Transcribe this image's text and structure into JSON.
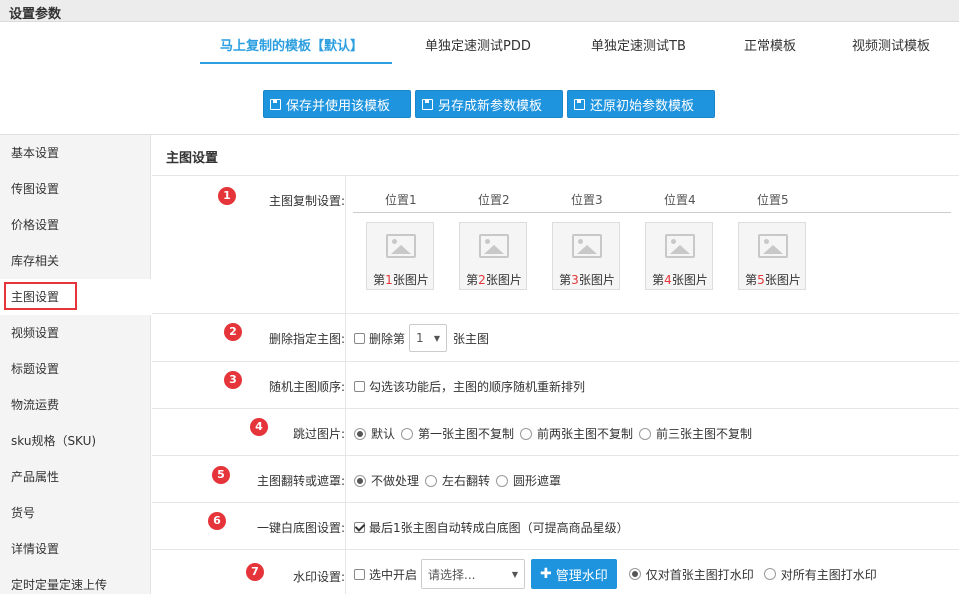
{
  "window": {
    "title": "设置参数"
  },
  "tabs": [
    {
      "label": "马上复制的模板【默认】",
      "active": true
    },
    {
      "label": "单独定速测试PDD",
      "active": false
    },
    {
      "label": "单独定速测试TB",
      "active": false
    },
    {
      "label": "正常模板",
      "active": false
    },
    {
      "label": "视频测试模板",
      "active": false
    }
  ],
  "actions": {
    "save_use": "保存并使用该模板",
    "save_as": "另存成新参数模板",
    "restore": "还原初始参数模板"
  },
  "sidebar": {
    "items": [
      {
        "label": "基本设置"
      },
      {
        "label": "传图设置"
      },
      {
        "label": "价格设置"
      },
      {
        "label": "库存相关"
      },
      {
        "label": "主图设置",
        "active": true
      },
      {
        "label": "视频设置"
      },
      {
        "label": "标题设置"
      },
      {
        "label": "物流运费"
      },
      {
        "label": "sku规格（SKU)"
      },
      {
        "label": "产品属性"
      },
      {
        "label": "货号"
      },
      {
        "label": "详情设置"
      },
      {
        "label": "定时定量定速上传"
      }
    ]
  },
  "main": {
    "title": "主图设置",
    "copy": {
      "badge": "1",
      "label": "主图复制设置:",
      "positions": [
        "位置1",
        "位置2",
        "位置3",
        "位置4",
        "位置5"
      ],
      "images": [
        {
          "prefix": "第",
          "num": "1",
          "suffix": "张图片"
        },
        {
          "prefix": "第",
          "num": "2",
          "suffix": "张图片"
        },
        {
          "prefix": "第",
          "num": "3",
          "suffix": "张图片"
        },
        {
          "prefix": "第",
          "num": "4",
          "suffix": "张图片"
        },
        {
          "prefix": "第",
          "num": "5",
          "suffix": "张图片"
        }
      ]
    },
    "delete": {
      "badge": "2",
      "label": "删除指定主图:",
      "checkbox_label": "删除第",
      "select_value": "1",
      "suffix": "张主图"
    },
    "random": {
      "badge": "3",
      "label": "随机主图顺序:",
      "checkbox_label": "勾选该功能后，主图的顺序随机重新排列"
    },
    "skip": {
      "badge": "4",
      "label": "跳过图片:",
      "options": [
        "默认",
        "第一张主图不复制",
        "前两张主图不复制",
        "前三张主图不复制"
      ],
      "selected": "默认"
    },
    "flip": {
      "badge": "5",
      "label": "主图翻转或遮罩:",
      "options": [
        "不做处理",
        "左右翻转",
        "圆形遮罩"
      ],
      "selected": "不做处理"
    },
    "whitebg": {
      "badge": "6",
      "label": "一键白底图设置:",
      "checkbox_label": "最后1张主图自动转成白底图（可提高商品星级）",
      "checked": true
    },
    "watermark": {
      "badge": "7",
      "label": "水印设置:",
      "checkbox_label": "选中开启",
      "select_placeholder": "请选择...",
      "manage_button": "管理水印",
      "options": [
        "仅对首张主图打水印",
        "对所有主图打水印"
      ],
      "selected": "仅对首张主图打水印"
    }
  }
}
